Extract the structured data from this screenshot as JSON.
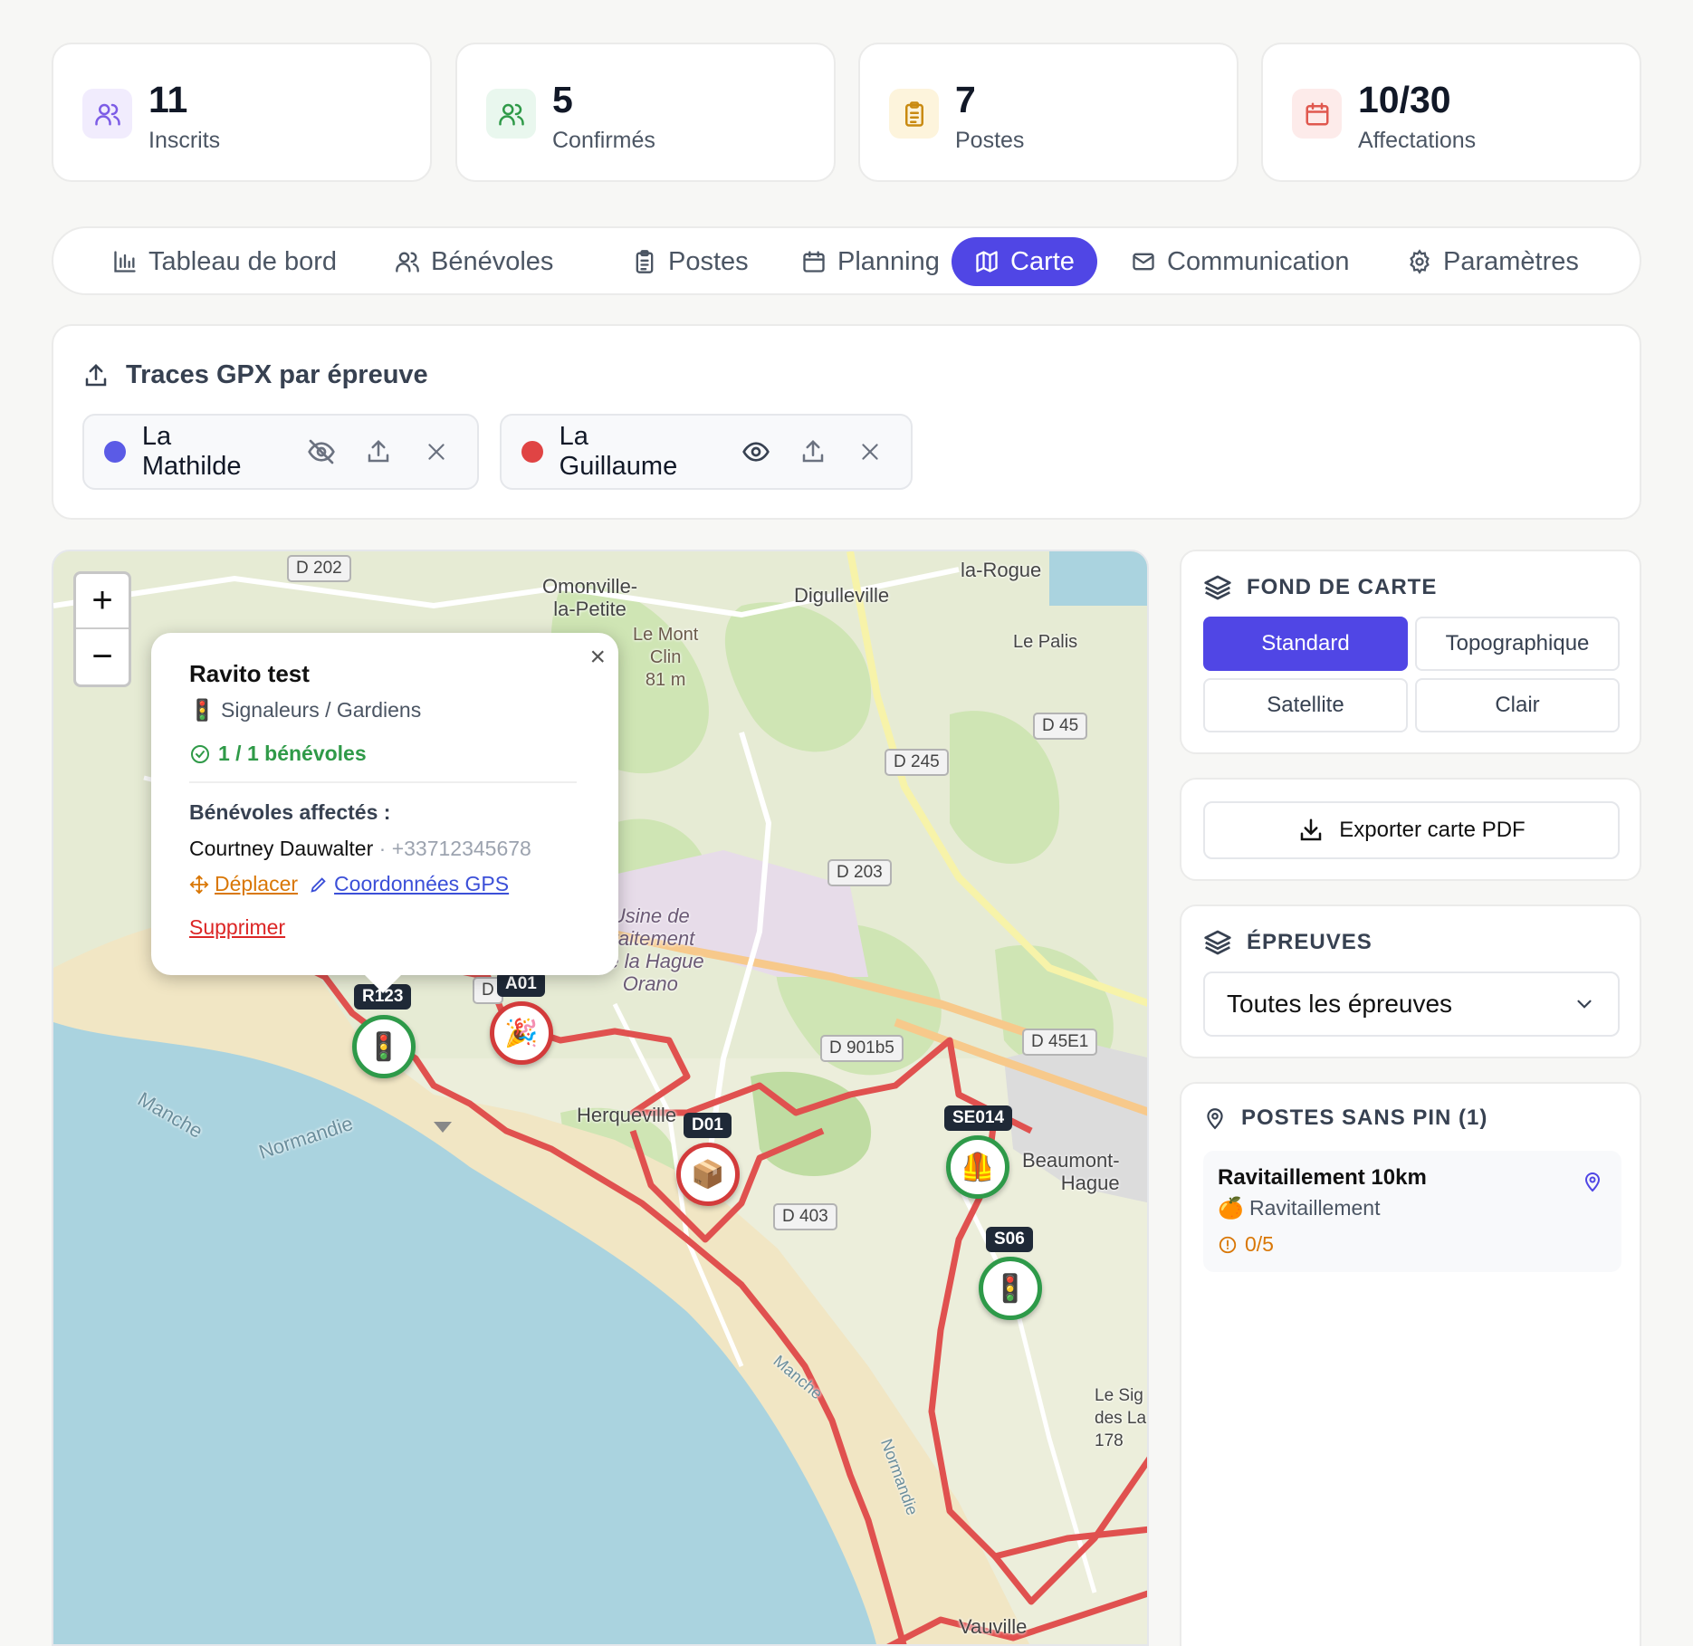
{
  "stats": [
    {
      "value": "11",
      "label": "Inscrits",
      "color": "#7c5ce6",
      "bg": "#f1ecfd",
      "icon": "users-icon"
    },
    {
      "value": "5",
      "label": "Confirmés",
      "color": "#2f9a48",
      "bg": "#e9f7ee",
      "icon": "users-icon"
    },
    {
      "value": "7",
      "label": "Postes",
      "color": "#c98a10",
      "bg": "#fdf4dc",
      "icon": "clipboard-icon"
    },
    {
      "value": "10/30",
      "label": "Affectations",
      "color": "#e0584f",
      "bg": "#fdebea",
      "icon": "calendar-icon"
    }
  ],
  "tabs": [
    {
      "label": "Tableau de bord",
      "icon": "bar-chart-icon"
    },
    {
      "label": "Bénévoles",
      "icon": "users-icon"
    },
    {
      "label": "Postes",
      "icon": "clipboard-icon"
    },
    {
      "label": "Planning",
      "icon": "calendar-icon"
    },
    {
      "label": "Carte",
      "icon": "map-icon",
      "active": true
    },
    {
      "label": "Communication",
      "icon": "mail-icon"
    },
    {
      "label": "Paramètres",
      "icon": "gear-icon"
    }
  ],
  "gpx": {
    "title": "Traces GPX par épreuve",
    "races": [
      {
        "name": "La Mathilde",
        "color": "#5b5be6",
        "visibility_icon": "eye-off-icon"
      },
      {
        "name": "La Guillaume",
        "color": "#e04444",
        "visibility_icon": "eye-icon"
      }
    ]
  },
  "map": {
    "zoom_in": "+",
    "zoom_out": "−",
    "roads": [
      "D 202",
      "D 45",
      "D 245",
      "D 203",
      "D 901b5",
      "D 45E1",
      "D 403",
      "D"
    ],
    "places": [
      "Omonville-\nla-Petite",
      "Digulleville",
      "la-Rogue",
      "Le Mont\nClin\n81 m",
      "Le Palis",
      "Usine de\ntraitement\nde la Hague\nOrano",
      "Herqueville",
      "Beaumont-\nHague",
      "Manche",
      "Normandie",
      "Le Sig\ndes La\n178",
      "Vauville",
      "Manche",
      "Normandie"
    ],
    "pins": [
      {
        "code": "R123",
        "emoji": "🚦",
        "status": "green"
      },
      {
        "code": "A01",
        "emoji": "🎉",
        "status": "red"
      },
      {
        "code": "D01",
        "emoji": "📦",
        "status": "red"
      },
      {
        "code": "SE014",
        "emoji": "🦺",
        "status": "green"
      },
      {
        "code": "S06",
        "emoji": "🚦",
        "status": "green"
      }
    ],
    "popup": {
      "title": "Ravito test",
      "type_emoji": "🚦",
      "type": "Signaleurs / Gardiens",
      "count": "1 / 1 bénévoles",
      "assigned_heading": "Bénévoles affectés :",
      "volunteer_name": "Courtney Dauwalter",
      "volunteer_phone": "· +33712345678",
      "move": "Déplacer",
      "gps": "Coordonnées GPS",
      "delete": "Supprimer",
      "close": "×"
    }
  },
  "basemap": {
    "title": "FOND DE CARTE",
    "options": [
      "Standard",
      "Topographique",
      "Satellite",
      "Clair"
    ],
    "selected": "Standard"
  },
  "export": {
    "label": "Exporter carte PDF"
  },
  "races_filter": {
    "title": "ÉPREUVES",
    "selected": "Toutes les épreuves"
  },
  "no_pin": {
    "title": "POSTES SANS PIN (1)",
    "items": [
      {
        "name": "Ravitaillement 10km",
        "type_emoji": "🍊",
        "type": "Ravitaillement",
        "count": "0/5"
      }
    ]
  },
  "colors": {
    "accent": "#5046e5",
    "track": "#e0514f",
    "sea": "#aad3df"
  }
}
